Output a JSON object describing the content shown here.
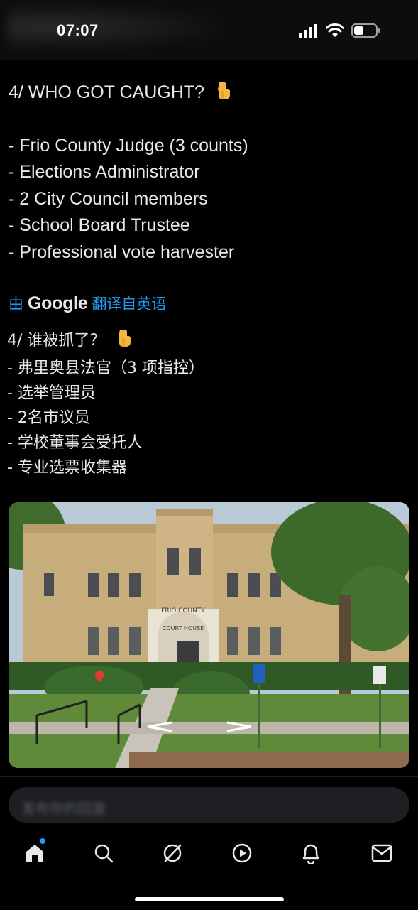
{
  "status_bar": {
    "time": "07:07",
    "icons": [
      "signal-icon",
      "wifi-icon",
      "battery-icon"
    ]
  },
  "tweet": {
    "heading": "4/ WHO GOT CAUGHT?",
    "heading_emoji": "pointing-down-emoji",
    "items": [
      "- Frio County Judge (3 counts)",
      "- Elections Administrator",
      "- 2 City Council members",
      "- School Board Trustee",
      "- Professional vote harvester"
    ]
  },
  "translation": {
    "prefix": "由",
    "provider": "Google",
    "suffix": "翻译自英语",
    "heading": "4/ 谁被抓了？",
    "items": [
      "- 弗里奥县法官（3 项指控）",
      "- 选举管理员",
      "- 2名市议员",
      "- 学校董事会受托人",
      "- 专业选票收集器"
    ]
  },
  "photo": {
    "alt_subject": "courthouse-photo",
    "sign_text_1": "FRIO COUNTY",
    "sign_text_2": "COURT HOUSE"
  },
  "reply": {
    "placeholder": "发布你的回复"
  },
  "nav": {
    "items": [
      "home-icon",
      "search-icon",
      "grok-icon",
      "video-icon",
      "notifications-icon",
      "messages-icon"
    ],
    "active": "home-icon"
  },
  "colors": {
    "accent": "#1d9bf0",
    "background": "#000000",
    "text": "#e7e9ea"
  }
}
